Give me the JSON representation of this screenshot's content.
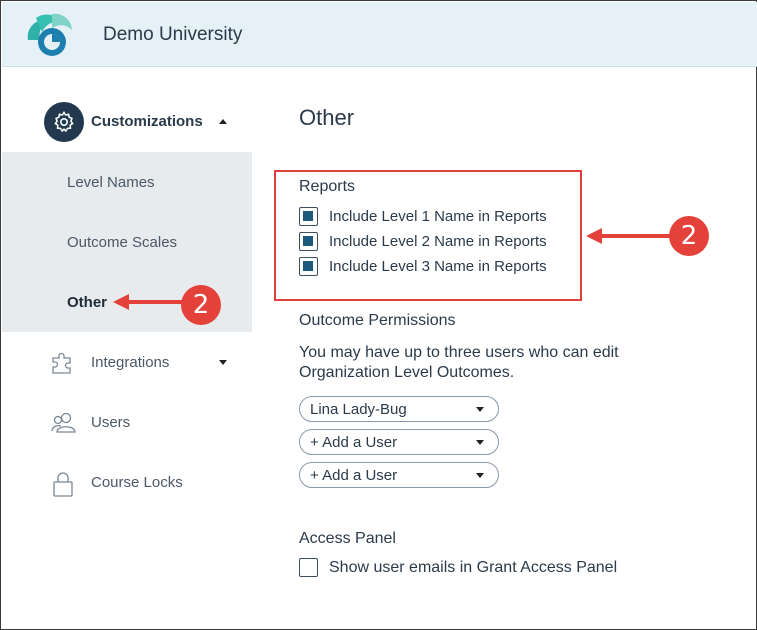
{
  "header": {
    "org_name": "Demo University"
  },
  "sidebar": {
    "section_label": "Customizations",
    "subitems": [
      {
        "label": "Level Names"
      },
      {
        "label": "Outcome Scales"
      },
      {
        "label": "Other",
        "active": true
      }
    ],
    "items": [
      {
        "label": "Integrations",
        "icon": "puzzle-icon",
        "expandable": true
      },
      {
        "label": "Users",
        "icon": "users-icon"
      },
      {
        "label": "Course Locks",
        "icon": "lock-icon"
      }
    ]
  },
  "main": {
    "title": "Other",
    "reports": {
      "title": "Reports",
      "options": [
        {
          "label": "Include Level 1 Name in Reports",
          "checked": true
        },
        {
          "label": "Include Level 2 Name in Reports",
          "checked": true
        },
        {
          "label": "Include Level 3 Name in Reports",
          "checked": true
        }
      ]
    },
    "permissions": {
      "title": "Outcome Permissions",
      "description": "You may have up to three users who can edit Organization Level Outcomes.",
      "users": [
        {
          "value": "Lina Lady-Bug"
        },
        {
          "value": "+ Add a User"
        },
        {
          "value": "+ Add a User"
        }
      ]
    },
    "access_panel": {
      "title": "Access Panel",
      "option": {
        "label": "Show user emails in Grant Access Panel",
        "checked": false
      }
    }
  },
  "callouts": [
    {
      "number": "2"
    },
    {
      "number": "2"
    }
  ],
  "colors": {
    "accent": "#1b5a7a",
    "header_bg": "#e6f1f7",
    "nav_dark": "#22394f",
    "subnav_bg": "#e7ebee",
    "callout": "#e4413a"
  }
}
